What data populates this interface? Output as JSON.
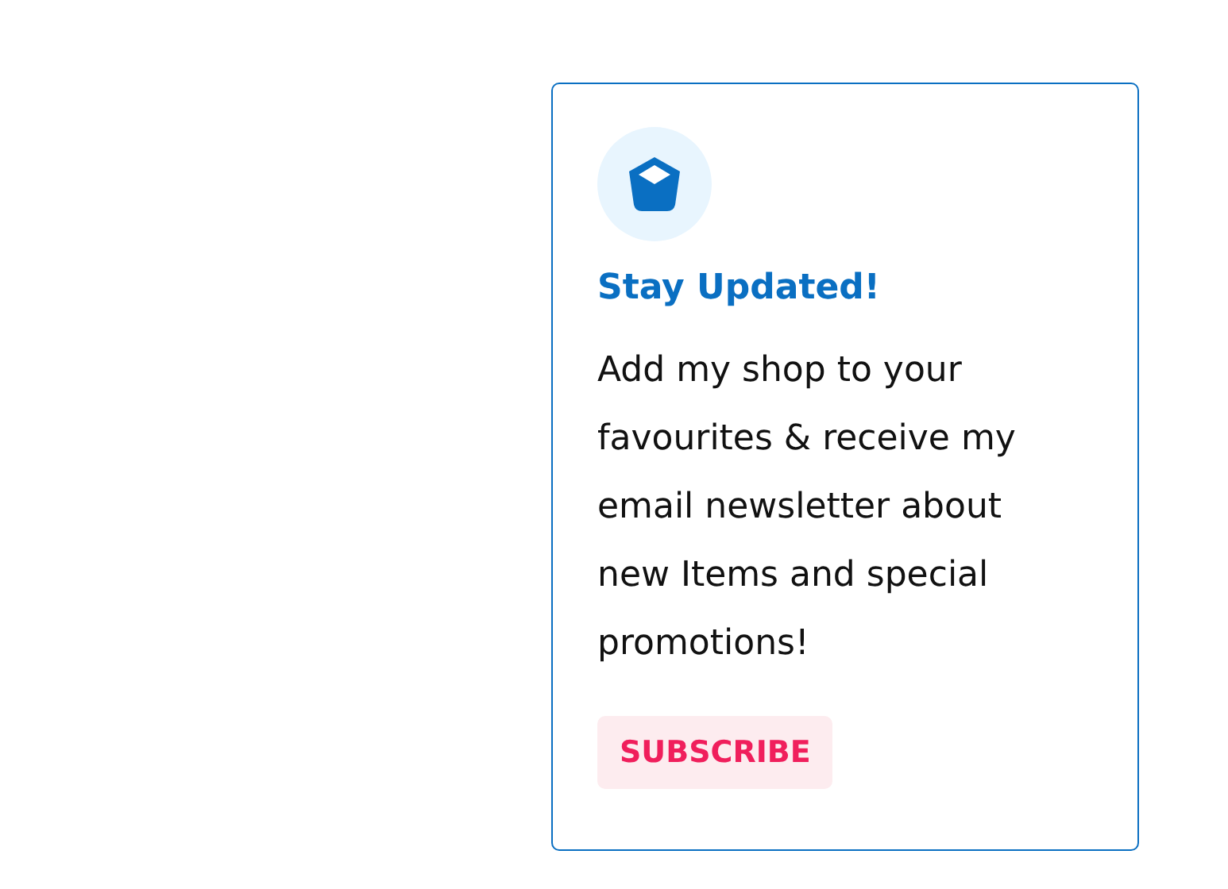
{
  "card": {
    "title": "Stay Updated!",
    "text": "Add my shop to your favourites & receive my email newsletter about new Items and special promotions!",
    "button": "SUBSCRIBE"
  }
}
